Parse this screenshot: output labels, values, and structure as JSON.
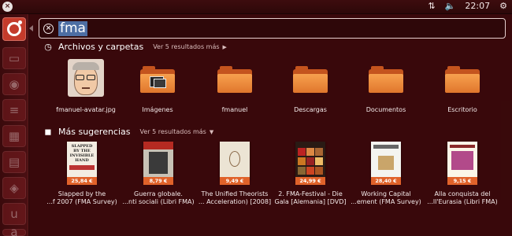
{
  "panel": {
    "window_buttons": [
      "close-icon",
      "minimize-icon",
      "maximize-icon"
    ],
    "time": "22:07",
    "tray_icons": [
      "network-updown-icon",
      "volume-icon",
      "settings-gear-icon"
    ]
  },
  "launcher": {
    "bfb_icon": "ubuntu-logo-icon",
    "items": [
      "files-icon",
      "firefox-icon",
      "writer-icon",
      "calc-icon",
      "impress-icon",
      "software-center-icon",
      "ubuntu-one-icon",
      "amazon-icon"
    ]
  },
  "search": {
    "query": "fma",
    "clear_icon": "clear-icon"
  },
  "files_category": {
    "icon": "clock-icon",
    "title": "Archivos y carpetas",
    "more": "Ver 5 resultados más",
    "items": [
      {
        "label": "fmanuel-avatar.jpg"
      },
      {
        "label": "Imágenes"
      },
      {
        "label": "fmanuel"
      },
      {
        "label": "Descargas"
      },
      {
        "label": "Documentos"
      },
      {
        "label": "Escritorio"
      }
    ]
  },
  "suggestions_category": {
    "icon": "shopping-bag-icon",
    "title": "Más sugerencias",
    "more": "Ver 5 resultados más",
    "items": [
      {
        "price": "25,84 €",
        "line1": "Slapped by the",
        "line2": "...f 2007 (FMA Survey)",
        "cover_text": "SLAPPED BY THE INVISIBLE HAND"
      },
      {
        "price": "8,79 €",
        "line1": "Guerra globale.",
        "line2": "...nti sociali (Libri FMA)",
        "cover_text": ""
      },
      {
        "price": "9,49 €",
        "line1": "The Unified Theorists",
        "line2": "... Acceleration) [2008]",
        "cover_text": ""
      },
      {
        "price": "24,99 €",
        "line1": "2. FMA-Festival - Die",
        "line2": "Gala [Alemania] [DVD]",
        "cover_text": ""
      },
      {
        "price": "28,40 €",
        "line1": "Working Capital",
        "line2": "...ement (FMA Survey)",
        "cover_text": ""
      },
      {
        "price": "9,15 €",
        "line1": "Alla conquista del",
        "line2": "...ll'Eurasia (Libri FMA)",
        "cover_text": ""
      }
    ]
  }
}
